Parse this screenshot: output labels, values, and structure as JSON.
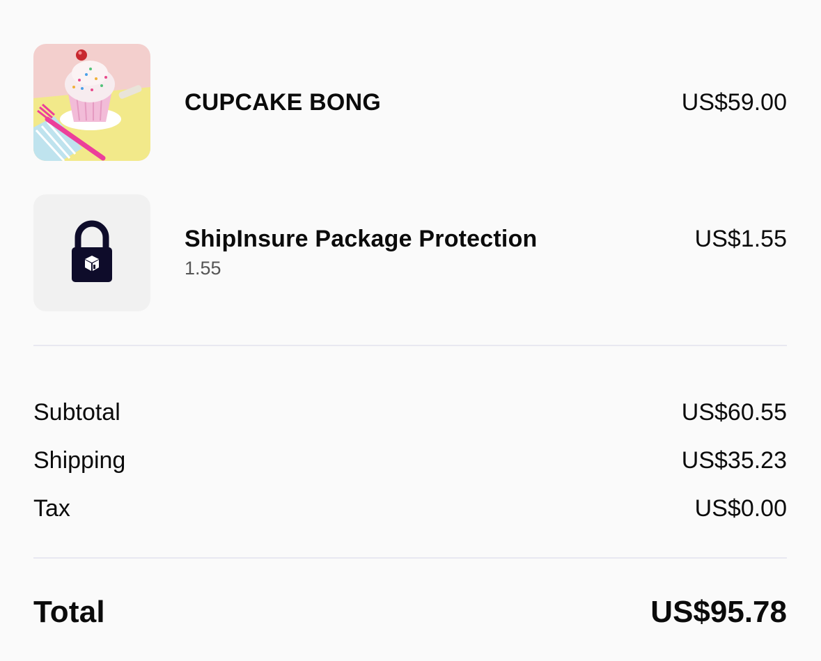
{
  "items": [
    {
      "name": "CUPCAKE BONG",
      "subtext": "",
      "price": "US$59.00",
      "image": "cupcake-product-photo"
    },
    {
      "name": "ShipInsure Package Protection",
      "subtext": "1.55",
      "price": "US$1.55",
      "image": "lock-icon"
    }
  ],
  "totals": {
    "subtotal_label": "Subtotal",
    "subtotal_value": "US$60.55",
    "shipping_label": "Shipping",
    "shipping_value": "US$35.23",
    "tax_label": "Tax",
    "tax_value": "US$0.00",
    "total_label": "Total",
    "total_value": "US$95.78"
  },
  "colors": {
    "background": "#fafafa",
    "divider": "#e8e8f1",
    "lock_icon": "#0e0c2a",
    "thumbnail_bg": "#f1f1f1"
  }
}
